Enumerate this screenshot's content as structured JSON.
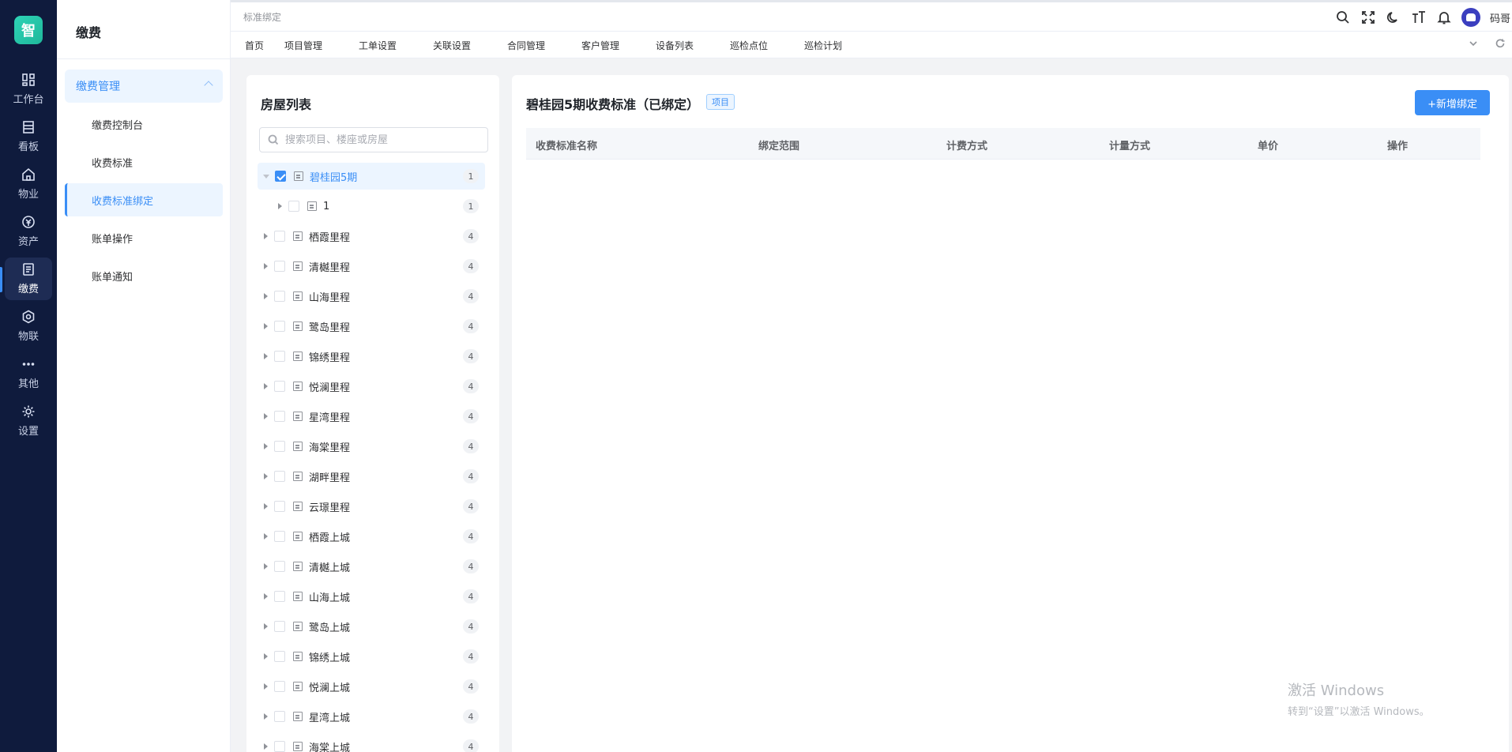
{
  "rail": {
    "logo": "智",
    "items": [
      {
        "label": "工作台",
        "icon": "dashboard-icon"
      },
      {
        "label": "看板",
        "icon": "board-icon"
      },
      {
        "label": "物业",
        "icon": "home-icon"
      },
      {
        "label": "资产",
        "icon": "asset-icon"
      },
      {
        "label": "缴费",
        "icon": "bill-icon"
      },
      {
        "label": "物联",
        "icon": "iot-icon"
      },
      {
        "label": "其他",
        "icon": "more-icon"
      },
      {
        "label": "设置",
        "icon": "settings-icon"
      }
    ]
  },
  "submenu": {
    "title": "缴费",
    "group": "缴费管理",
    "items": [
      "缴费控制台",
      "收费标准",
      "收费标准绑定",
      "账单操作",
      "账单通知"
    ]
  },
  "header": {
    "crumb": "标准绑定",
    "user": "码哥"
  },
  "tabs": [
    "首页",
    "项目管理",
    "工单设置",
    "关联设置",
    "合同管理",
    "客户管理",
    "设备列表",
    "巡检点位",
    "巡检计划"
  ],
  "tree": {
    "title": "房屋列表",
    "search_placeholder": "搜索项目、楼座或房屋",
    "root": {
      "label": "碧桂园5期",
      "count": "1"
    },
    "child": {
      "label": "1",
      "count": "1"
    },
    "nodes": [
      {
        "label": "栖霞里程",
        "count": "4"
      },
      {
        "label": "清樾里程",
        "count": "4"
      },
      {
        "label": "山海里程",
        "count": "4"
      },
      {
        "label": "鹭岛里程",
        "count": "4"
      },
      {
        "label": "锦绣里程",
        "count": "4"
      },
      {
        "label": "悦澜里程",
        "count": "4"
      },
      {
        "label": "星湾里程",
        "count": "4"
      },
      {
        "label": "海棠里程",
        "count": "4"
      },
      {
        "label": "湖畔里程",
        "count": "4"
      },
      {
        "label": "云璟里程",
        "count": "4"
      },
      {
        "label": "栖霞上城",
        "count": "4"
      },
      {
        "label": "清樾上城",
        "count": "4"
      },
      {
        "label": "山海上城",
        "count": "4"
      },
      {
        "label": "鹭岛上城",
        "count": "4"
      },
      {
        "label": "锦绣上城",
        "count": "4"
      },
      {
        "label": "悦澜上城",
        "count": "4"
      },
      {
        "label": "星湾上城",
        "count": "4"
      },
      {
        "label": "海棠上城",
        "count": "4"
      }
    ]
  },
  "main": {
    "title": "碧桂园5期收费标准（已绑定）",
    "tag": "项目",
    "add_button": "+新增绑定",
    "columns": [
      "收费标准名称",
      "绑定范围",
      "计费方式",
      "计量方式",
      "单价",
      "操作"
    ]
  },
  "watermark": {
    "line1": "激活 Windows",
    "line2": "转到“设置”以激活 Windows。"
  }
}
